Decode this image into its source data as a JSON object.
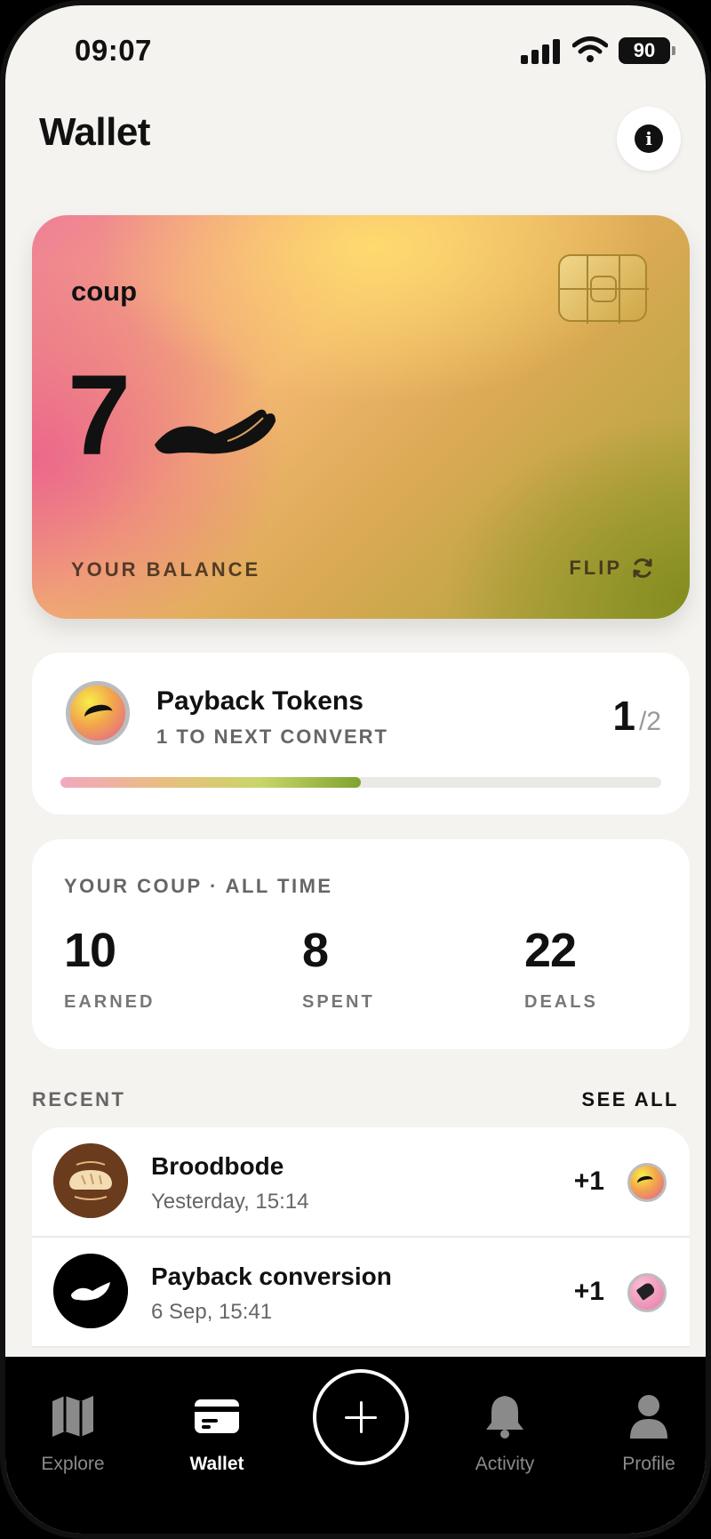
{
  "status_bar": {
    "time": "09:07",
    "battery": "90"
  },
  "header": {
    "title": "Wallet"
  },
  "card": {
    "brand": "coup",
    "balance": "7",
    "balance_label": "YOUR BALANCE",
    "flip_label": "FLIP"
  },
  "tokens": {
    "name": "Payback Tokens",
    "subtitle": "1 TO NEXT CONVERT",
    "current": "1",
    "total": "/2",
    "progress_fraction": 0.5
  },
  "stats": {
    "heading": "YOUR COUP · ALL TIME",
    "items": [
      {
        "value": "10",
        "label": "EARNED"
      },
      {
        "value": "8",
        "label": "SPENT"
      },
      {
        "value": "22",
        "label": "DEALS"
      }
    ]
  },
  "recent": {
    "heading": "RECENT",
    "see_all": "SEE ALL",
    "items": [
      {
        "name": "Broodbode",
        "time": "Yesterday, 15:14",
        "delta": "+1",
        "icon": "bread-avatar"
      },
      {
        "name": "Payback conversion",
        "time": "6 Sep, 15:41",
        "delta": "+1",
        "icon": "payback-avatar"
      }
    ]
  },
  "tabbar": {
    "items": [
      {
        "label": "Explore",
        "icon": "map-icon"
      },
      {
        "label": "Wallet",
        "icon": "wallet-icon"
      },
      {
        "label": "Activity",
        "icon": "bell-icon"
      },
      {
        "label": "Profile",
        "icon": "person-icon"
      }
    ],
    "add_icon": "plus-icon"
  },
  "colors": {
    "background": "#f4f3ef",
    "card_pink": "#ef7f96",
    "card_gold": "#f2b770",
    "card_olive": "#a7a43a",
    "tabbar": "#000000"
  }
}
